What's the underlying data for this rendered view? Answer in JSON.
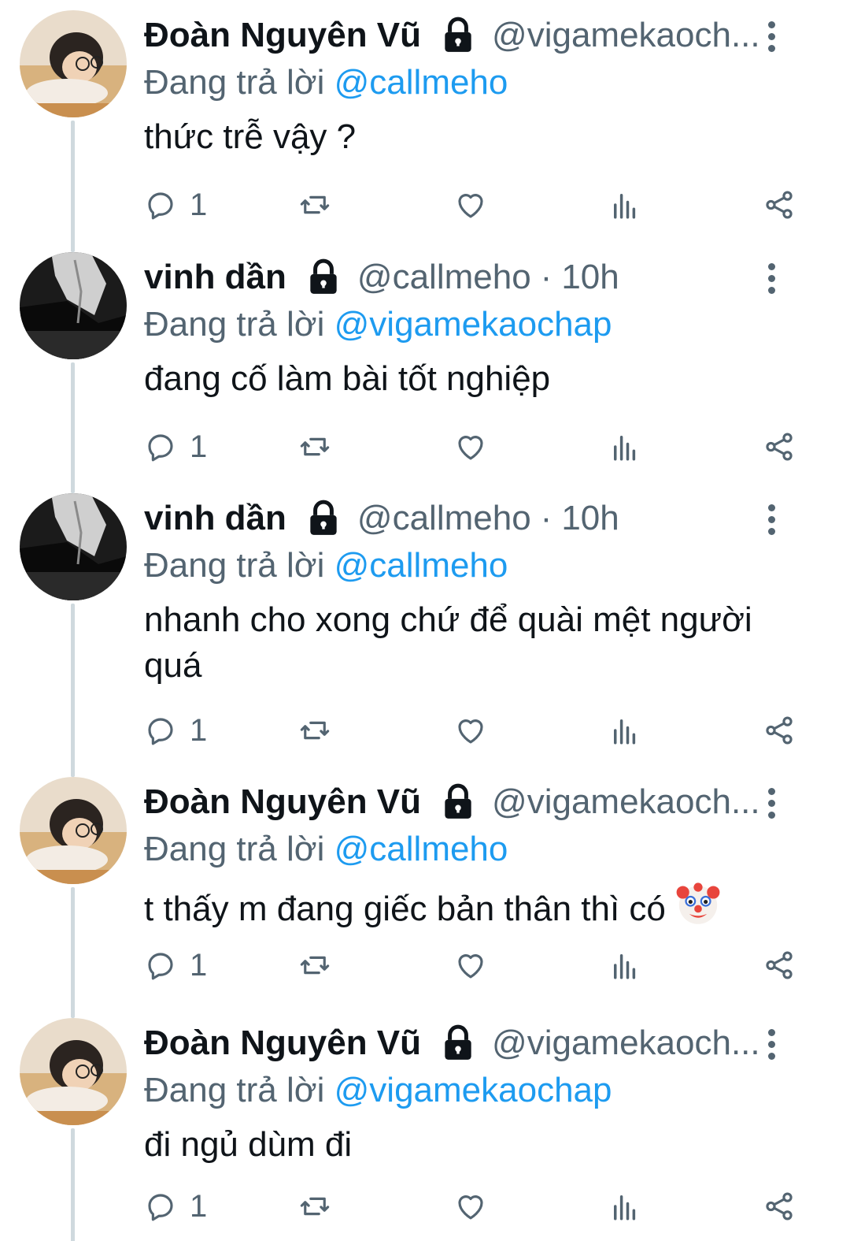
{
  "colors": {
    "text": "#0f1419",
    "secondary": "#536471",
    "mention": "#1d9bf0",
    "thread_line": "#cfd9de"
  },
  "tweets": [
    {
      "name": "Đoàn Nguyên Vũ",
      "handle": "@vigamekaoch...",
      "time": "",
      "replying_prefix": "Đang trả lời",
      "replying_to": "@callmeho",
      "text": "thức trễ vậy ?",
      "reply_count": "1",
      "avatar": "avatar-portrait",
      "emoji": ""
    },
    {
      "name": "vinh dần",
      "handle": "@callmeho",
      "time": "10h",
      "replying_prefix": "Đang trả lời",
      "replying_to": "@vigamekaochap",
      "text": "đang cố làm bài tốt nghiệp",
      "reply_count": "1",
      "avatar": "avatar-dark",
      "emoji": ""
    },
    {
      "name": "vinh dần",
      "handle": "@callmeho",
      "time": "10h",
      "replying_prefix": "Đang trả lời",
      "replying_to": "@callmeho",
      "text": "nhanh cho xong chứ để quài mệt người quá",
      "reply_count": "1",
      "avatar": "avatar-dark",
      "emoji": ""
    },
    {
      "name": "Đoàn Nguyên Vũ",
      "handle": "@vigamekaoch...",
      "time": "",
      "replying_prefix": "Đang trả lời",
      "replying_to": "@callmeho",
      "text": "t thấy m đang giếc bản thân thì có",
      "reply_count": "1",
      "avatar": "avatar-portrait",
      "emoji": "clown-face-icon"
    },
    {
      "name": "Đoàn Nguyên Vũ",
      "handle": "@vigamekaoch...",
      "time": "",
      "replying_prefix": "Đang trả lời",
      "replying_to": "@vigamekaochap",
      "text": "đi ngủ dùm đi",
      "reply_count": "1",
      "avatar": "avatar-portrait",
      "emoji": ""
    }
  ]
}
